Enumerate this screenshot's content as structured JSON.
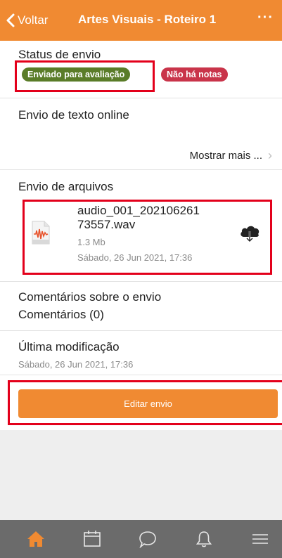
{
  "header": {
    "back_label": "Voltar",
    "title": "Artes Visuais - Roteiro 1",
    "more_label": "···",
    "color": "#f08a32"
  },
  "status": {
    "label": "Status de envio",
    "badge_submitted": "Enviado para avaliação",
    "badge_grade": "Não há notas",
    "submitted_color": "#5a7c28",
    "grade_color": "#c9344a"
  },
  "online_text": {
    "label": "Envio de texto online",
    "show_more": "Mostrar mais ..."
  },
  "files": {
    "label": "Envio de arquivos",
    "items": [
      {
        "name_line1": "audio_001_202106261",
        "name_line2": "73557.wav",
        "size": "1.3 Mb",
        "date": "Sábado, 26 Jun 2021, 17:36",
        "icon": "audio-file-icon"
      }
    ]
  },
  "comments": {
    "label": "Comentários sobre o envio",
    "count_label": "Comentários (0)"
  },
  "last_modified": {
    "label": "Última modificação",
    "date": "Sábado, 26 Jun 2021, 17:36"
  },
  "edit_button": {
    "label": "Editar envio"
  },
  "tabbar": {
    "items": [
      {
        "icon": "home-icon",
        "active": true
      },
      {
        "icon": "calendar-icon",
        "active": false
      },
      {
        "icon": "chat-icon",
        "active": false
      },
      {
        "icon": "bell-icon",
        "active": false
      },
      {
        "icon": "menu-icon",
        "active": false
      }
    ],
    "active_color": "#f08a32"
  },
  "highlight_color": "#e3001b"
}
